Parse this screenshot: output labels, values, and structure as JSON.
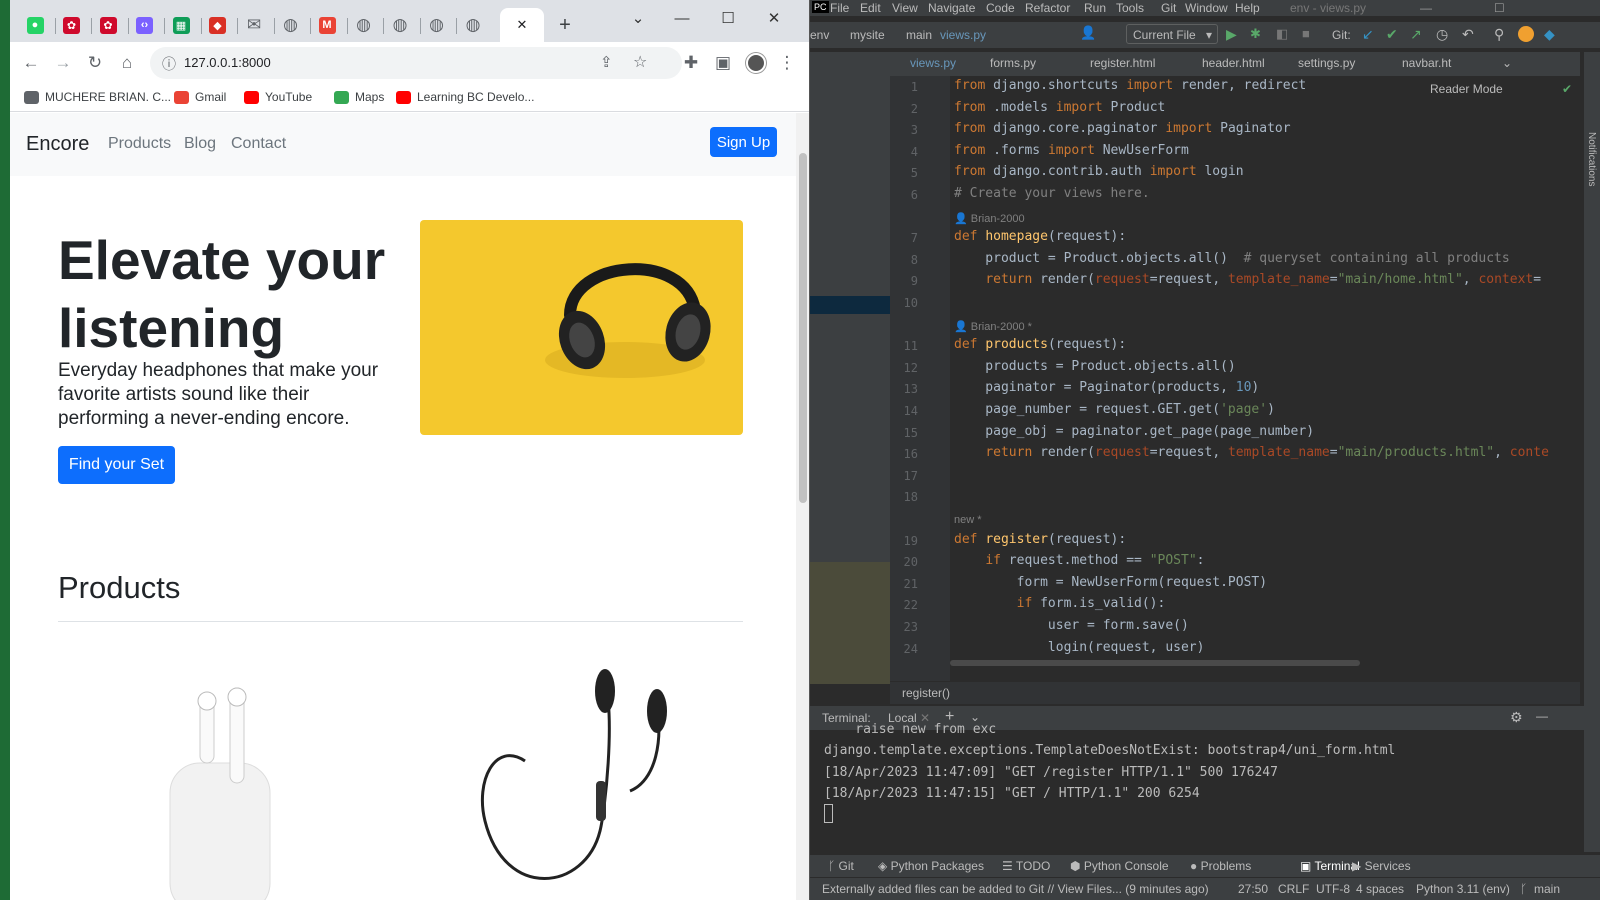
{
  "browser": {
    "tabs": [
      {
        "icon": "whatsapp-icon",
        "color": "#25d366"
      },
      {
        "icon": "huawei-icon",
        "color": "#cf0a2c"
      },
      {
        "icon": "huawei-icon",
        "color": "#cf0a2c"
      },
      {
        "icon": "code-icon",
        "color": "#7b61ff"
      },
      {
        "icon": "sheet-icon",
        "color": "#0f9d58"
      },
      {
        "icon": "app-icon",
        "color": "#d93025"
      },
      {
        "icon": "mail-icon",
        "color": "#5f6368"
      },
      {
        "icon": "globe-icon",
        "color": "#5f6368"
      },
      {
        "icon": "gmail-icon",
        "color": "#ea4335"
      },
      {
        "icon": "globe-icon",
        "color": "#5f6368"
      },
      {
        "icon": "globe-icon",
        "color": "#5f6368"
      },
      {
        "icon": "globe-icon",
        "color": "#5f6368"
      },
      {
        "icon": "globe-icon",
        "color": "#5f6368"
      }
    ],
    "url": "127.0.0.1:8000",
    "bookmarks": [
      {
        "label": "MUCHERE BRIAN. C...",
        "color": "#5f6368"
      },
      {
        "label": "Gmail",
        "color": "#ea4335"
      },
      {
        "label": "YouTube",
        "color": "#ff0000"
      },
      {
        "label": "Maps",
        "color": "#34a853"
      },
      {
        "label": "Learning BC Develo...",
        "color": "#ff0000"
      }
    ],
    "page": {
      "brand": "Encore",
      "nav": [
        "Products",
        "Blog",
        "Contact"
      ],
      "signup": "Sign Up",
      "hero_title": "Elevate your listening",
      "hero_subtitle": "Everyday headphones that make your favorite artists sound like their performing a never-ending encore.",
      "cta": "Find your Set",
      "products_heading": "Products"
    }
  },
  "ide": {
    "menu": [
      "File",
      "Edit",
      "View",
      "Navigate",
      "Code",
      "Refactor",
      "Run",
      "Tools",
      "Git",
      "Window",
      "Help"
    ],
    "window_title": "env - views.py",
    "nav": {
      "project": "env",
      "path1": "mysite",
      "path2": "main",
      "file": "views.py",
      "run_config": "Current File",
      "git": "Git:"
    },
    "tabs": [
      "views.py",
      "forms.py",
      "register.html",
      "header.html",
      "settings.py",
      "navbar.ht"
    ],
    "reader_mode": "Reader Mode",
    "author1": "Brian-2000",
    "author2": "Brian-2000 *",
    "new_hint": "new *",
    "breadcrumb": "register()",
    "terminal": {
      "label": "Terminal:",
      "tab": "Local",
      "lines": [
        "    raise new from exc",
        "django.template.exceptions.TemplateDoesNotExist: bootstrap4/uni_form.html",
        "[18/Apr/2023 11:47:09] \"GET /register HTTP/1.1\" 500 176247",
        "[18/Apr/2023 11:47:15] \"GET / HTTP/1.1\" 200 6254"
      ]
    },
    "toolwindows": [
      "Git",
      "Python Packages",
      "TODO",
      "Python Console",
      "Problems",
      "Terminal",
      "Services"
    ],
    "status": {
      "message": "Externally added files can be added to Git // View Files... (9 minutes ago)",
      "position": "27:50",
      "line_sep": "CRLF",
      "encoding": "UTF-8",
      "indent": "4 spaces",
      "interpreter": "Python 3.11 (env)",
      "branch": "main"
    },
    "side_labels": {
      "notifications": "Notifications"
    }
  }
}
